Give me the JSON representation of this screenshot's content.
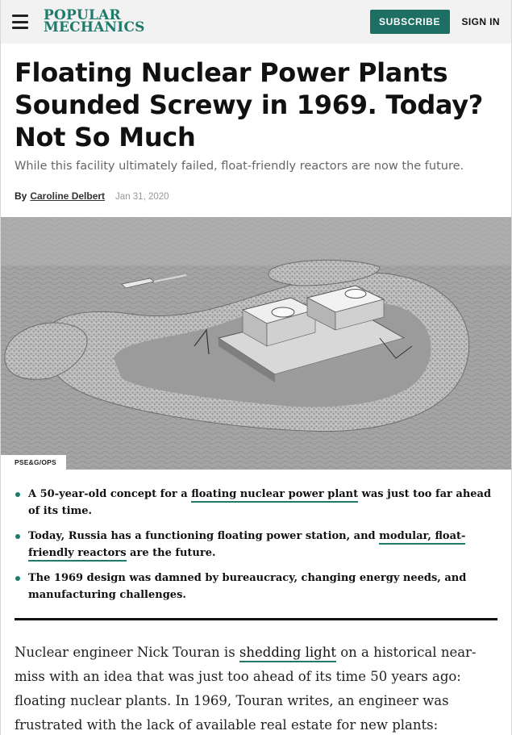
{
  "header": {
    "logo_line1": "POPULAR",
    "logo_line2": "MECHANICS",
    "subscribe_label": "SUBSCRIBE",
    "signin_label": "SIGN IN",
    "brand_color": "#1e6f63"
  },
  "article": {
    "headline": "Floating Nuclear Power Plants Sounded Screwy in 1969. Today? Not So Much",
    "dek": "While this facility ultimately failed, float-friendly reactors are now the future.",
    "byline_prefix": "By",
    "author": "Caroline Delbert",
    "date": "Jan 31, 2020",
    "image_credit": "PSE&G/OPS"
  },
  "bullets": [
    {
      "before": "A 50-year-old concept for a ",
      "link": "floating nuclear power plant",
      "after": " was just too far ahead of its time."
    },
    {
      "before": "Today, Russia has a functioning floating power station, and ",
      "link": "modular, float-friendly reactors",
      "after": " are the future."
    },
    {
      "before": "The 1969 design was damned by bureaucracy, changing energy needs, and manufacturing challenges.",
      "link": "",
      "after": ""
    }
  ],
  "body": {
    "before": "Nuclear engineer Nick Touran is ",
    "link": "shedding light",
    "after": " on a historical near-miss with an idea that was just too ahead of its time 50 years ago: floating nuclear plants. In 1969, Touran writes, an engineer was frustrated with the lack of available real estate for new plants:"
  }
}
